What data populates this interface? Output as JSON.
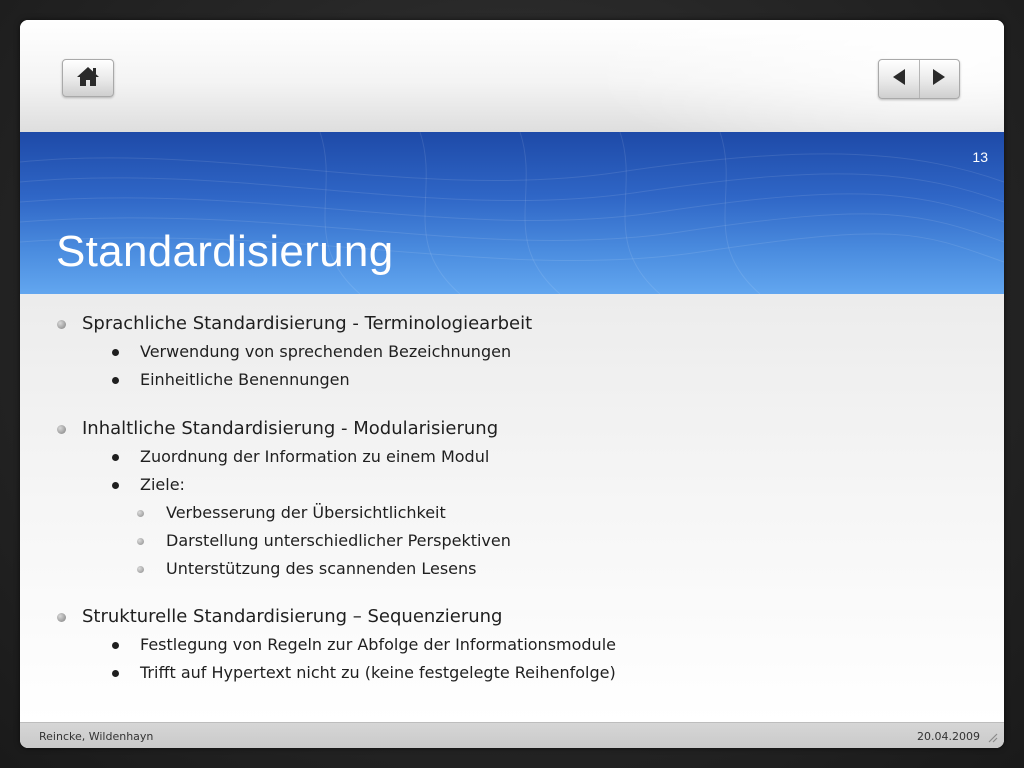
{
  "slide": {
    "number": "13",
    "title": "Standardisierung"
  },
  "nav": {
    "home_icon": "home-icon",
    "prev_icon": "triangle-left-icon",
    "next_icon": "triangle-right-icon"
  },
  "content": {
    "s1": {
      "heading": "Sprachliche Standardisierung - Terminologiearbeit",
      "items": [
        "Verwendung von sprechenden Bezeichnungen",
        "Einheitliche Benennungen"
      ]
    },
    "s2": {
      "heading": "Inhaltliche Standardisierung - Modularisierung",
      "items": [
        "Zuordnung der Information zu einem Modul",
        "Ziele:"
      ],
      "subitems": [
        "Verbesserung der Übersichtlichkeit",
        "Darstellung unterschiedlicher Perspektiven",
        "Unterstützung des scannenden Lesens"
      ]
    },
    "s3": {
      "heading": "Strukturelle Standardisierung – Sequenzierung",
      "items": [
        "Festlegung von Regeln zur Abfolge der Informationsmodule",
        "Trifft auf Hypertext nicht zu (keine festgelegte Reihenfolge)"
      ]
    }
  },
  "footer": {
    "author": "Reincke, Wildenhayn",
    "date": "20.04.2009"
  },
  "colors": {
    "title_band": "#2f66c6",
    "title_text": "#ffffff",
    "body_text": "#1f1f1f",
    "background": "#262626"
  }
}
